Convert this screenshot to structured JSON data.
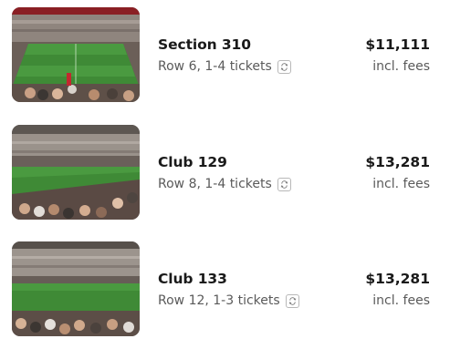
{
  "listings": [
    {
      "section": "Section 310",
      "row": "Row 6, 1-4 tickets",
      "price": "$11,111",
      "fees_note": "incl. fees",
      "swap_icon": "swap-arrows-icon"
    },
    {
      "section": "Club 129",
      "row": "Row 8, 1-4 tickets",
      "price": "$13,281",
      "fees_note": "incl. fees",
      "swap_icon": "swap-arrows-icon"
    },
    {
      "section": "Club 133",
      "row": "Row 12, 1-3 tickets",
      "price": "$13,281",
      "fees_note": "incl. fees",
      "swap_icon": "swap-arrows-icon"
    }
  ],
  "colors": {
    "title": "#1a1a1a",
    "muted": "#5a5a5a",
    "pitch_green": "#3f8a36",
    "badge_border": "#b8b8b8"
  }
}
